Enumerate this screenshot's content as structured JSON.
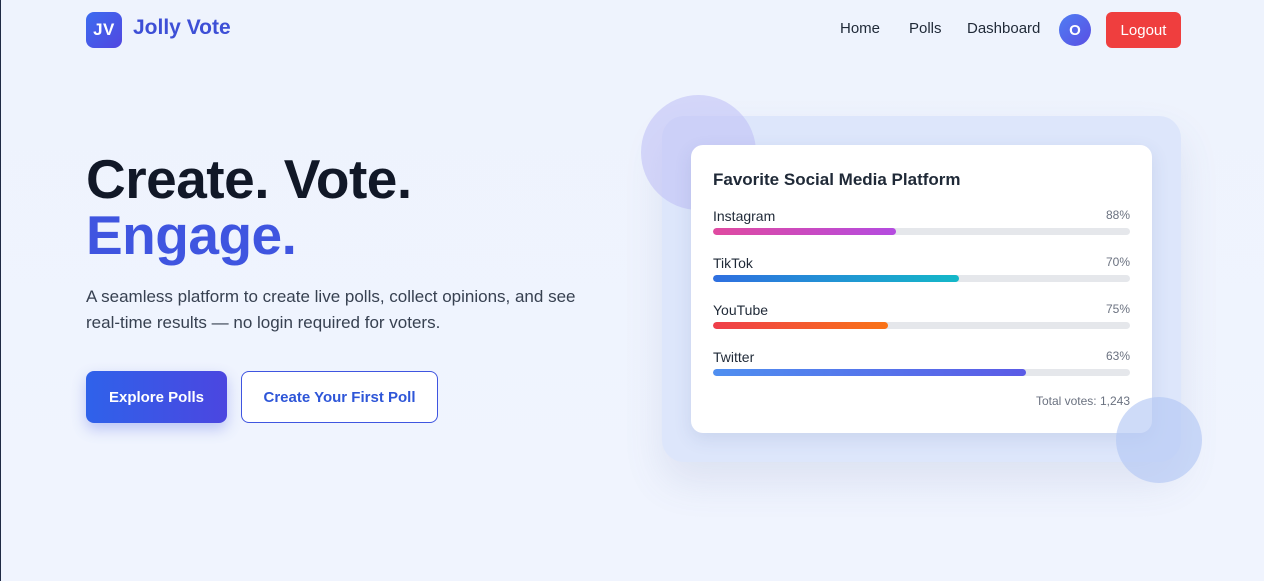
{
  "nav": {
    "logo_initials": "JV",
    "brand": "Jolly Vote",
    "links": [
      "Home",
      "Polls",
      "Dashboard"
    ],
    "avatar_initial": "O",
    "logout_label": "Logout"
  },
  "hero": {
    "heading_line1": "Create. Vote.",
    "heading_line2": "Engage.",
    "lead": "A seamless platform to create live polls, collect opinions, and see real-time results — no login required for voters.",
    "primary_button": "Explore Polls",
    "secondary_button": "Create Your First Poll"
  },
  "poll_card": {
    "title": "Favorite Social Media Platform",
    "options": [
      {
        "label": "Instagram",
        "percent_label": "88%",
        "fill_fraction": 0.44,
        "gradient": [
          "#e04aa0",
          "#b44be0"
        ]
      },
      {
        "label": "TikTok",
        "percent_label": "70%",
        "fill_fraction": 0.59,
        "gradient": [
          "#2f6fe0",
          "#14b8c8"
        ]
      },
      {
        "label": "YouTube",
        "percent_label": "75%",
        "fill_fraction": 0.42,
        "gradient": [
          "#ef3e4a",
          "#f97316"
        ]
      },
      {
        "label": "Twitter",
        "percent_label": "63%",
        "fill_fraction": 0.75,
        "gradient": [
          "#4f8ff0",
          "#5b5be6"
        ]
      }
    ],
    "total_votes": "Total votes: 1,243"
  },
  "colors": {
    "accent": "#3f55e0",
    "logout": "#ef3e3e",
    "background": "#eef3fd"
  }
}
